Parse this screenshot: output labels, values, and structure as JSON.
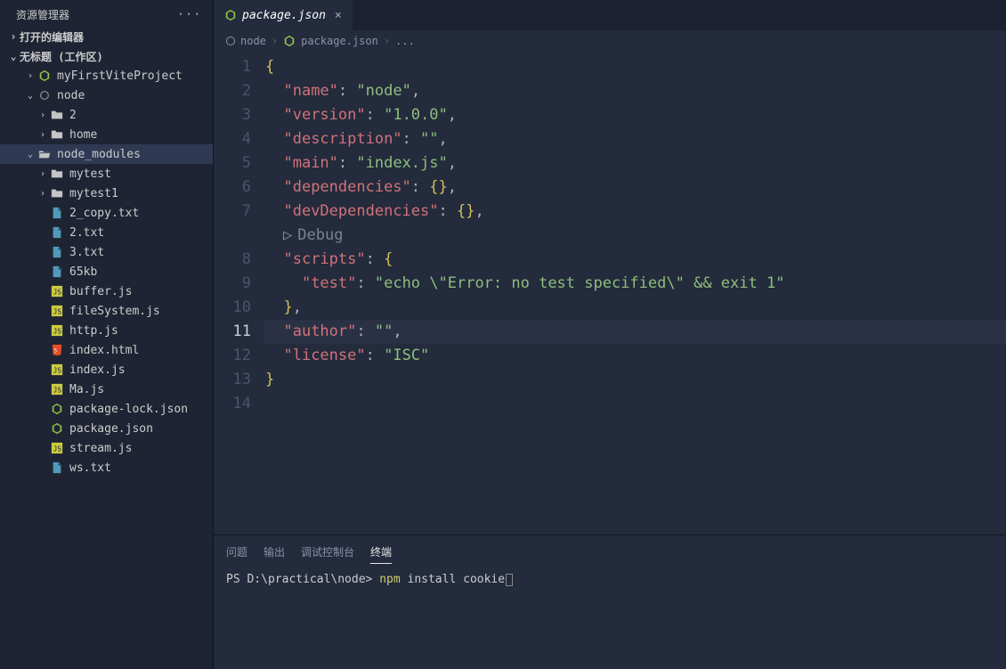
{
  "sidebar": {
    "title": "资源管理器",
    "sections": {
      "openEditors": "打开的编辑器",
      "workspace": "无标题 (工作区)"
    },
    "tree": [
      {
        "level": 1,
        "chev": ">",
        "icon": "hex",
        "iconClass": "fi-json",
        "label": "myFirstViteProject"
      },
      {
        "level": 1,
        "chev": "v",
        "icon": "circle",
        "iconClass": "fi-circle",
        "label": "node"
      },
      {
        "level": 2,
        "chev": ">",
        "icon": "folder",
        "iconClass": "fi-folder",
        "label": "2"
      },
      {
        "level": 2,
        "chev": ">",
        "icon": "folder",
        "iconClass": "fi-folder",
        "label": "home"
      },
      {
        "level": 1,
        "chev": "v",
        "icon": "folder-open",
        "iconClass": "fi-folder",
        "label": "node_modules",
        "selected": true
      },
      {
        "level": 2,
        "chev": ">",
        "icon": "folder",
        "iconClass": "fi-folder",
        "label": "mytest"
      },
      {
        "level": 2,
        "chev": ">",
        "icon": "folder",
        "iconClass": "fi-folder",
        "label": "mytest1"
      },
      {
        "level": 2,
        "chev": "",
        "icon": "file",
        "iconClass": "fi-txt",
        "label": "2_copy.txt"
      },
      {
        "level": 2,
        "chev": "",
        "icon": "file",
        "iconClass": "fi-txt",
        "label": "2.txt"
      },
      {
        "level": 2,
        "chev": "",
        "icon": "file",
        "iconClass": "fi-txt",
        "label": "3.txt"
      },
      {
        "level": 2,
        "chev": "",
        "icon": "file",
        "iconClass": "fi-txt",
        "label": "65kb"
      },
      {
        "level": 2,
        "chev": "",
        "icon": "js",
        "iconClass": "fi-js",
        "label": "buffer.js"
      },
      {
        "level": 2,
        "chev": "",
        "icon": "js",
        "iconClass": "fi-js",
        "label": "fileSystem.js"
      },
      {
        "level": 2,
        "chev": "",
        "icon": "js",
        "iconClass": "fi-js",
        "label": "http.js"
      },
      {
        "level": 2,
        "chev": "",
        "icon": "html",
        "iconClass": "fi-html",
        "label": "index.html"
      },
      {
        "level": 2,
        "chev": "",
        "icon": "js",
        "iconClass": "fi-js",
        "label": "index.js"
      },
      {
        "level": 2,
        "chev": "",
        "icon": "js",
        "iconClass": "fi-js",
        "label": "Ma.js"
      },
      {
        "level": 2,
        "chev": "",
        "icon": "hex",
        "iconClass": "fi-json",
        "label": "package-lock.json"
      },
      {
        "level": 2,
        "chev": "",
        "icon": "hex",
        "iconClass": "fi-json",
        "label": "package.json"
      },
      {
        "level": 2,
        "chev": "",
        "icon": "js",
        "iconClass": "fi-js",
        "label": "stream.js"
      },
      {
        "level": 2,
        "chev": "",
        "icon": "file",
        "iconClass": "fi-txt",
        "label": "ws.txt"
      }
    ]
  },
  "tab": {
    "label": "package.json"
  },
  "breadcrumb": {
    "items": [
      "node",
      "package.json",
      "..."
    ]
  },
  "editor": {
    "activeLine": 11,
    "debugLabel": "Debug",
    "lines": [
      {
        "n": 1,
        "tokens": [
          [
            "brace",
            "{"
          ]
        ]
      },
      {
        "n": 2,
        "tokens": [
          [
            "pad",
            "  "
          ],
          [
            "key",
            "\"name\""
          ],
          [
            "colon",
            ": "
          ],
          [
            "str",
            "\"node\""
          ],
          [
            "punc",
            ","
          ]
        ]
      },
      {
        "n": 3,
        "tokens": [
          [
            "pad",
            "  "
          ],
          [
            "key",
            "\"version\""
          ],
          [
            "colon",
            ": "
          ],
          [
            "str",
            "\"1.0.0\""
          ],
          [
            "punc",
            ","
          ]
        ]
      },
      {
        "n": 4,
        "tokens": [
          [
            "pad",
            "  "
          ],
          [
            "key",
            "\"description\""
          ],
          [
            "colon",
            ": "
          ],
          [
            "str",
            "\"\""
          ],
          [
            "punc",
            ","
          ]
        ]
      },
      {
        "n": 5,
        "tokens": [
          [
            "pad",
            "  "
          ],
          [
            "key",
            "\"main\""
          ],
          [
            "colon",
            ": "
          ],
          [
            "str",
            "\"index.js\""
          ],
          [
            "punc",
            ","
          ]
        ]
      },
      {
        "n": 6,
        "tokens": [
          [
            "pad",
            "  "
          ],
          [
            "key",
            "\"dependencies\""
          ],
          [
            "colon",
            ": "
          ],
          [
            "brace",
            "{}"
          ],
          [
            "punc",
            ","
          ]
        ]
      },
      {
        "n": 7,
        "tokens": [
          [
            "pad",
            "  "
          ],
          [
            "key",
            "\"devDependencies\""
          ],
          [
            "colon",
            ": "
          ],
          [
            "brace",
            "{}"
          ],
          [
            "punc",
            ","
          ]
        ]
      },
      {
        "n": "debug"
      },
      {
        "n": 8,
        "tokens": [
          [
            "pad",
            "  "
          ],
          [
            "key",
            "\"scripts\""
          ],
          [
            "colon",
            ": "
          ],
          [
            "brace",
            "{"
          ]
        ]
      },
      {
        "n": 9,
        "tokens": [
          [
            "pad",
            "    "
          ],
          [
            "key",
            "\"test\""
          ],
          [
            "colon",
            ": "
          ],
          [
            "str",
            "\"echo \\\"Error: no test specified\\\" && exit 1\""
          ]
        ]
      },
      {
        "n": 10,
        "tokens": [
          [
            "pad",
            "  "
          ],
          [
            "brace",
            "}"
          ],
          [
            "punc",
            ","
          ]
        ]
      },
      {
        "n": 11,
        "tokens": [
          [
            "pad",
            "  "
          ],
          [
            "key",
            "\"author\""
          ],
          [
            "colon",
            ": "
          ],
          [
            "str",
            "\"\""
          ],
          [
            "punc",
            ","
          ]
        ]
      },
      {
        "n": 12,
        "tokens": [
          [
            "pad",
            "  "
          ],
          [
            "key",
            "\"license\""
          ],
          [
            "colon",
            ": "
          ],
          [
            "str",
            "\"ISC\""
          ]
        ]
      },
      {
        "n": 13,
        "tokens": [
          [
            "brace",
            "}"
          ]
        ]
      },
      {
        "n": 14,
        "tokens": []
      }
    ]
  },
  "panel": {
    "tabs": [
      "问题",
      "输出",
      "调试控制台",
      "终端"
    ],
    "active": 3,
    "terminal": {
      "prompt": "PS D:\\practical\\node> ",
      "cmd1": "npm",
      "cmd2": " install cookie"
    }
  }
}
